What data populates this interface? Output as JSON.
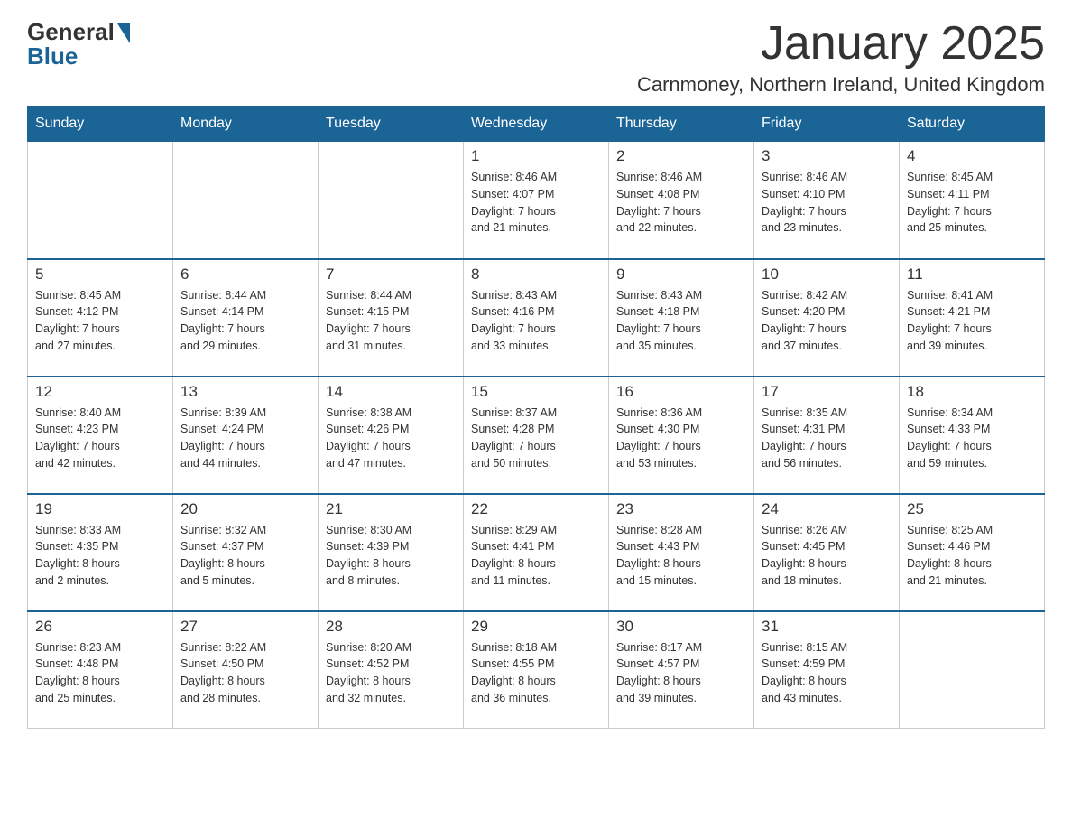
{
  "header": {
    "logo_general": "General",
    "logo_blue": "Blue",
    "month_title": "January 2025",
    "location": "Carnmoney, Northern Ireland, United Kingdom"
  },
  "weekdays": [
    "Sunday",
    "Monday",
    "Tuesday",
    "Wednesday",
    "Thursday",
    "Friday",
    "Saturday"
  ],
  "weeks": [
    [
      {
        "day": "",
        "info": ""
      },
      {
        "day": "",
        "info": ""
      },
      {
        "day": "",
        "info": ""
      },
      {
        "day": "1",
        "info": "Sunrise: 8:46 AM\nSunset: 4:07 PM\nDaylight: 7 hours\nand 21 minutes."
      },
      {
        "day": "2",
        "info": "Sunrise: 8:46 AM\nSunset: 4:08 PM\nDaylight: 7 hours\nand 22 minutes."
      },
      {
        "day": "3",
        "info": "Sunrise: 8:46 AM\nSunset: 4:10 PM\nDaylight: 7 hours\nand 23 minutes."
      },
      {
        "day": "4",
        "info": "Sunrise: 8:45 AM\nSunset: 4:11 PM\nDaylight: 7 hours\nand 25 minutes."
      }
    ],
    [
      {
        "day": "5",
        "info": "Sunrise: 8:45 AM\nSunset: 4:12 PM\nDaylight: 7 hours\nand 27 minutes."
      },
      {
        "day": "6",
        "info": "Sunrise: 8:44 AM\nSunset: 4:14 PM\nDaylight: 7 hours\nand 29 minutes."
      },
      {
        "day": "7",
        "info": "Sunrise: 8:44 AM\nSunset: 4:15 PM\nDaylight: 7 hours\nand 31 minutes."
      },
      {
        "day": "8",
        "info": "Sunrise: 8:43 AM\nSunset: 4:16 PM\nDaylight: 7 hours\nand 33 minutes."
      },
      {
        "day": "9",
        "info": "Sunrise: 8:43 AM\nSunset: 4:18 PM\nDaylight: 7 hours\nand 35 minutes."
      },
      {
        "day": "10",
        "info": "Sunrise: 8:42 AM\nSunset: 4:20 PM\nDaylight: 7 hours\nand 37 minutes."
      },
      {
        "day": "11",
        "info": "Sunrise: 8:41 AM\nSunset: 4:21 PM\nDaylight: 7 hours\nand 39 minutes."
      }
    ],
    [
      {
        "day": "12",
        "info": "Sunrise: 8:40 AM\nSunset: 4:23 PM\nDaylight: 7 hours\nand 42 minutes."
      },
      {
        "day": "13",
        "info": "Sunrise: 8:39 AM\nSunset: 4:24 PM\nDaylight: 7 hours\nand 44 minutes."
      },
      {
        "day": "14",
        "info": "Sunrise: 8:38 AM\nSunset: 4:26 PM\nDaylight: 7 hours\nand 47 minutes."
      },
      {
        "day": "15",
        "info": "Sunrise: 8:37 AM\nSunset: 4:28 PM\nDaylight: 7 hours\nand 50 minutes."
      },
      {
        "day": "16",
        "info": "Sunrise: 8:36 AM\nSunset: 4:30 PM\nDaylight: 7 hours\nand 53 minutes."
      },
      {
        "day": "17",
        "info": "Sunrise: 8:35 AM\nSunset: 4:31 PM\nDaylight: 7 hours\nand 56 minutes."
      },
      {
        "day": "18",
        "info": "Sunrise: 8:34 AM\nSunset: 4:33 PM\nDaylight: 7 hours\nand 59 minutes."
      }
    ],
    [
      {
        "day": "19",
        "info": "Sunrise: 8:33 AM\nSunset: 4:35 PM\nDaylight: 8 hours\nand 2 minutes."
      },
      {
        "day": "20",
        "info": "Sunrise: 8:32 AM\nSunset: 4:37 PM\nDaylight: 8 hours\nand 5 minutes."
      },
      {
        "day": "21",
        "info": "Sunrise: 8:30 AM\nSunset: 4:39 PM\nDaylight: 8 hours\nand 8 minutes."
      },
      {
        "day": "22",
        "info": "Sunrise: 8:29 AM\nSunset: 4:41 PM\nDaylight: 8 hours\nand 11 minutes."
      },
      {
        "day": "23",
        "info": "Sunrise: 8:28 AM\nSunset: 4:43 PM\nDaylight: 8 hours\nand 15 minutes."
      },
      {
        "day": "24",
        "info": "Sunrise: 8:26 AM\nSunset: 4:45 PM\nDaylight: 8 hours\nand 18 minutes."
      },
      {
        "day": "25",
        "info": "Sunrise: 8:25 AM\nSunset: 4:46 PM\nDaylight: 8 hours\nand 21 minutes."
      }
    ],
    [
      {
        "day": "26",
        "info": "Sunrise: 8:23 AM\nSunset: 4:48 PM\nDaylight: 8 hours\nand 25 minutes."
      },
      {
        "day": "27",
        "info": "Sunrise: 8:22 AM\nSunset: 4:50 PM\nDaylight: 8 hours\nand 28 minutes."
      },
      {
        "day": "28",
        "info": "Sunrise: 8:20 AM\nSunset: 4:52 PM\nDaylight: 8 hours\nand 32 minutes."
      },
      {
        "day": "29",
        "info": "Sunrise: 8:18 AM\nSunset: 4:55 PM\nDaylight: 8 hours\nand 36 minutes."
      },
      {
        "day": "30",
        "info": "Sunrise: 8:17 AM\nSunset: 4:57 PM\nDaylight: 8 hours\nand 39 minutes."
      },
      {
        "day": "31",
        "info": "Sunrise: 8:15 AM\nSunset: 4:59 PM\nDaylight: 8 hours\nand 43 minutes."
      },
      {
        "day": "",
        "info": ""
      }
    ]
  ]
}
